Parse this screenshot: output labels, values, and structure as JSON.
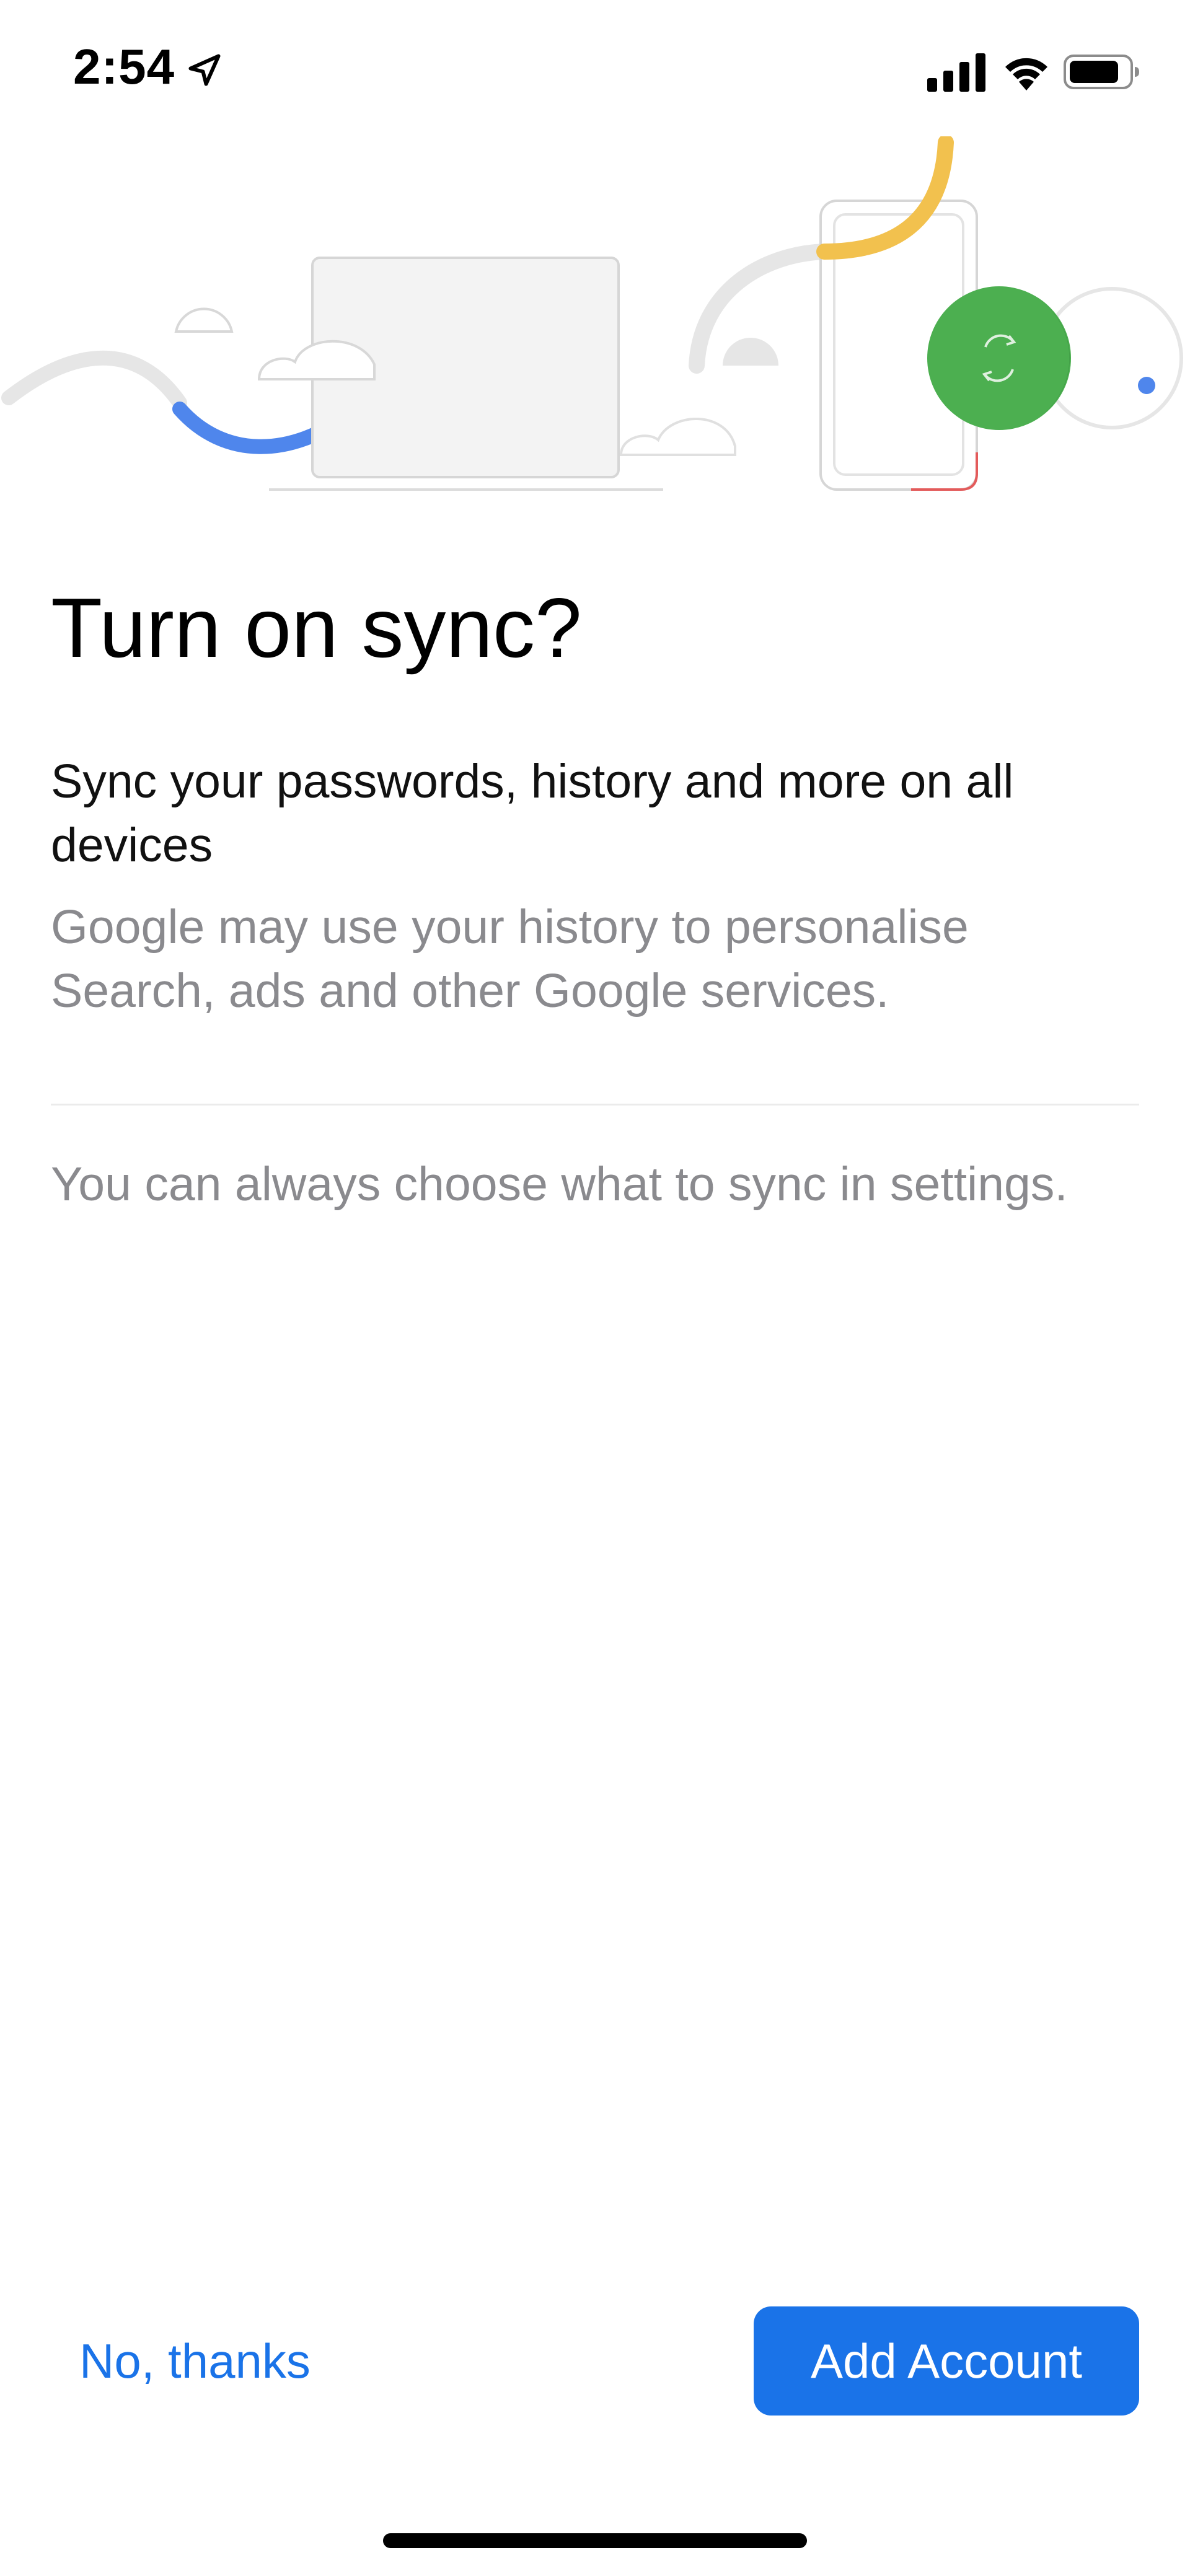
{
  "status_bar": {
    "time": "2:54",
    "icons": [
      "location-arrow-icon",
      "cellular-signal-icon",
      "wifi-icon",
      "battery-icon"
    ]
  },
  "illustration": {
    "icons": [
      "laptop-icon",
      "phone-icon",
      "sync-icon",
      "cloud-icon"
    ],
    "colors": {
      "blue": "#4f86ec",
      "yellow": "#f2c14e",
      "green": "#4caf50",
      "red": "#e35b5b",
      "grey": "#e6e6e6"
    }
  },
  "content": {
    "title": "Turn on sync?",
    "subtitle": "Sync your passwords, history and more on all devices",
    "description": "Google may use your history to personalise Search, ads and other Google services.",
    "settings_note": "You can always choose what to sync in settings."
  },
  "actions": {
    "no_thanks_label": "No, thanks",
    "add_account_label": "Add Account"
  },
  "colors": {
    "accent": "#1a73e8",
    "secondary_text": "#8a8a8e"
  }
}
